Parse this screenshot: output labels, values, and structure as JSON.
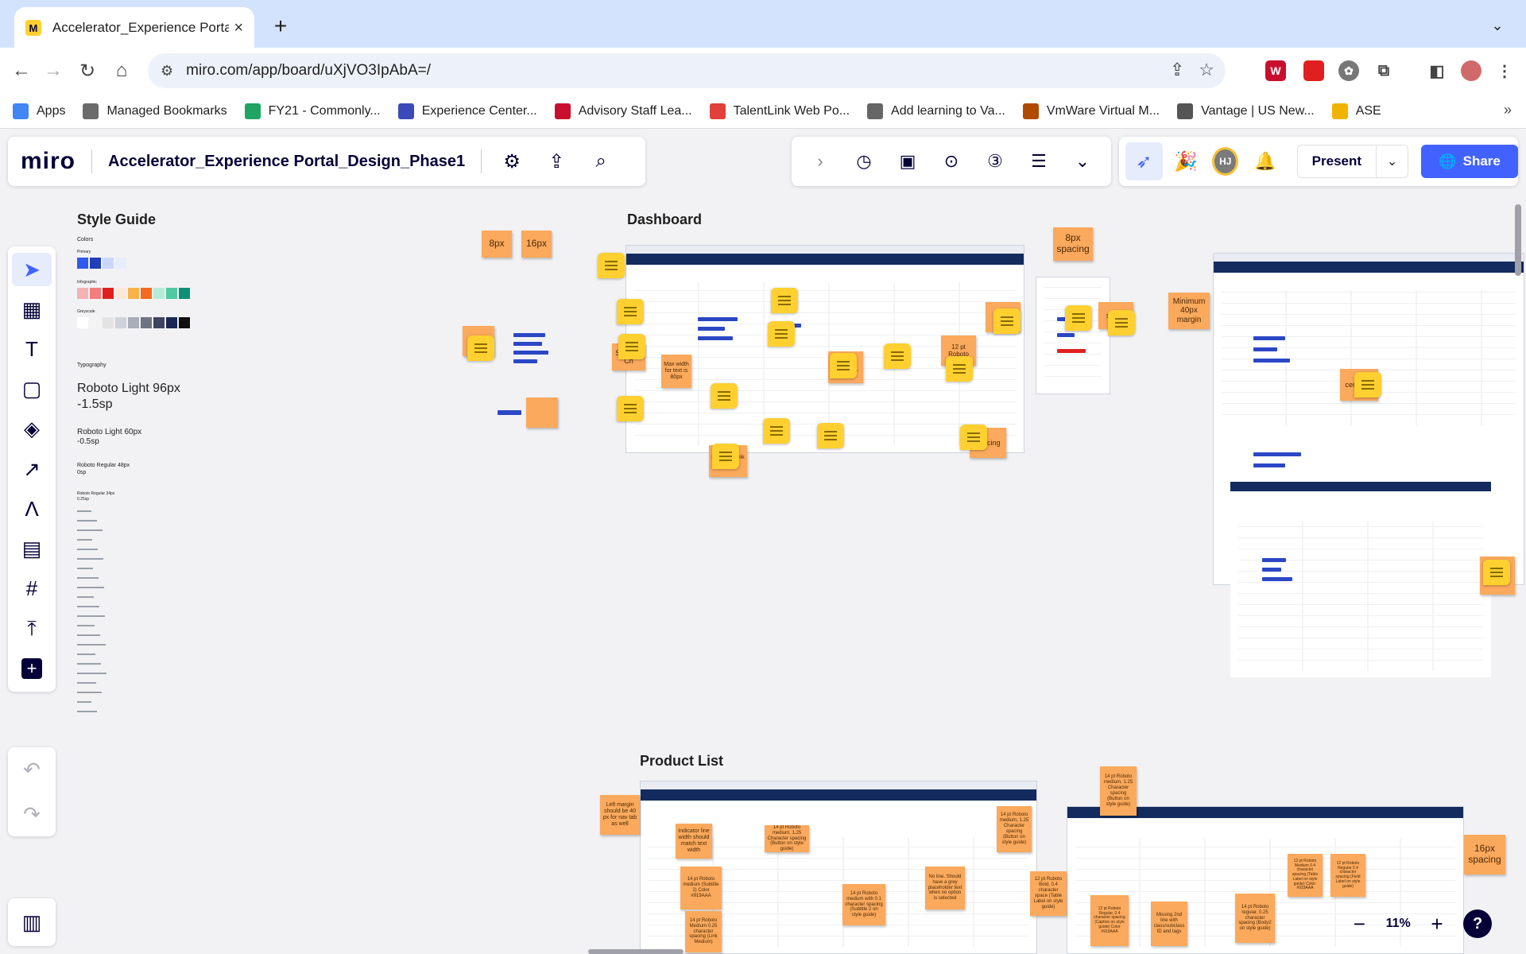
{
  "browser": {
    "tab_title": "Accelerator_Experience Portal_Design_Phase1",
    "url": "miro.com/app/board/uXjVO3IpAbA=/",
    "bookmarks": [
      {
        "label": "Apps",
        "color": "#4285f4"
      },
      {
        "label": "Managed Bookmarks",
        "color": "#6b6b6b"
      },
      {
        "label": "FY21 - Commonly...",
        "color": "#1fa463"
      },
      {
        "label": "Experience Center...",
        "color": "#3a4bb8"
      },
      {
        "label": "Advisory Staff Lea...",
        "color": "#c8102e"
      },
      {
        "label": "TalentLink Web Po...",
        "color": "#e2403a"
      },
      {
        "label": "Add learning to Va...",
        "color": "#666666"
      },
      {
        "label": "VmWare Virtual M...",
        "color": "#b04a00"
      },
      {
        "label": "Vantage | US New...",
        "color": "#555555"
      },
      {
        "label": "ASE",
        "color": "#f0b400"
      }
    ]
  },
  "miro": {
    "logo": "miro",
    "board_title": "Accelerator_Experience Portal_Design_Phase1",
    "avatar_initials": "HJ",
    "present_label": "Present",
    "share_label": "Share",
    "zoom": "11%",
    "help": "?",
    "accent_color": "#4262ff"
  },
  "canvas": {
    "frames": {
      "style_guide": "Style Guide",
      "dashboard": "Dashboard",
      "product_list": "Product List"
    },
    "style_guide": {
      "colors_label": "Colors",
      "primary_label": "Primary",
      "infographic_label": "Infographic",
      "greyscale_label": "Greyscale",
      "typography_label": "Typography",
      "h1": "Roboto Light 96px",
      "h1_sub": "-1.5sp",
      "h2": "Roboto Light 60px",
      "h2_sub": "-0.5sp",
      "h3": "Roboto Regular 48px",
      "h3_sub": "0sp",
      "h4": "Roboto Regular 34px",
      "h4_sub": "0.25sp",
      "primary_colors": [
        "#2f5bea",
        "#2140b8",
        "#c9d6ff",
        "#e7edff"
      ],
      "infographic_colors": [
        "#f5b3b3",
        "#f47c7c",
        "#e02020",
        "#fbe8d9",
        "#f7b24a",
        "#f26b21",
        "#b6ecd7",
        "#4fc9a2",
        "#0f8f78"
      ],
      "greyscale_colors": [
        "#ffffff",
        "#f3f3f3",
        "#e3e3e3",
        "#cfd2d8",
        "#a9adb8",
        "#6e7385",
        "#3e4560",
        "#1b2752",
        "#101010"
      ]
    },
    "stickies": {
      "s8px": "8px",
      "s16px": "16px",
      "s8px_spacing": "8px spacing",
      "min_margin": "Minimum 40px margin",
      "centered": "centered",
      "color": "color",
      "space": "space",
      "spacing": "spacing",
      "shack": "Shack & Ch",
      "max_width": "Max width for text is 80px",
      "roboto_12": "12 pt Roboto",
      "color_919": "Color #919AAA",
      "spacing_medium": "spacing (Link Medium)",
      "left_margin": "Left margin should be 40 px for nav tab as well",
      "indicator": "Indicator line width should match text width",
      "roboto_medium": "14 pt Roboto medium (Subtitle 2) Color #919AAA",
      "roboto_link": "14 pt Roboto Medium 0.25 character spacing (Link Medium)",
      "subtitle_2": "14 pt Roboto medium with 0.1 character spacing (Subtitle 2 on style guide)",
      "no_line": "No line. Should have a grey placeholder text when no option is selected",
      "bold_table": "12 pt Roboto Bold, 0.4 character space (Table Label on style guide)",
      "button_style": "14 pt Roboto medium, 1.25 Character spacing (Button on style guide)",
      "top_medium": "14 pt Roboto medium, 1.25 Character spacing (Button on style guide)",
      "s16px_spacing": "16px spacing",
      "missing_line": "Missing 2nd line with class/subclass ID and tags",
      "body_2": "14 pt Roboto regular, 0.25 character spacing (Body2 on style guide)",
      "caption": "12 pt Roboto Regular, 0.4 character spacing (Caption on style guide) Color #919AAA",
      "table_label": "12 pt Roboto Medium 0.4 character spacing (Table Label on style guide) Color: #919AAA",
      "field_label": "12 pt Roboto Regular 0.4 character spacing (Field Label on style guide)"
    }
  }
}
